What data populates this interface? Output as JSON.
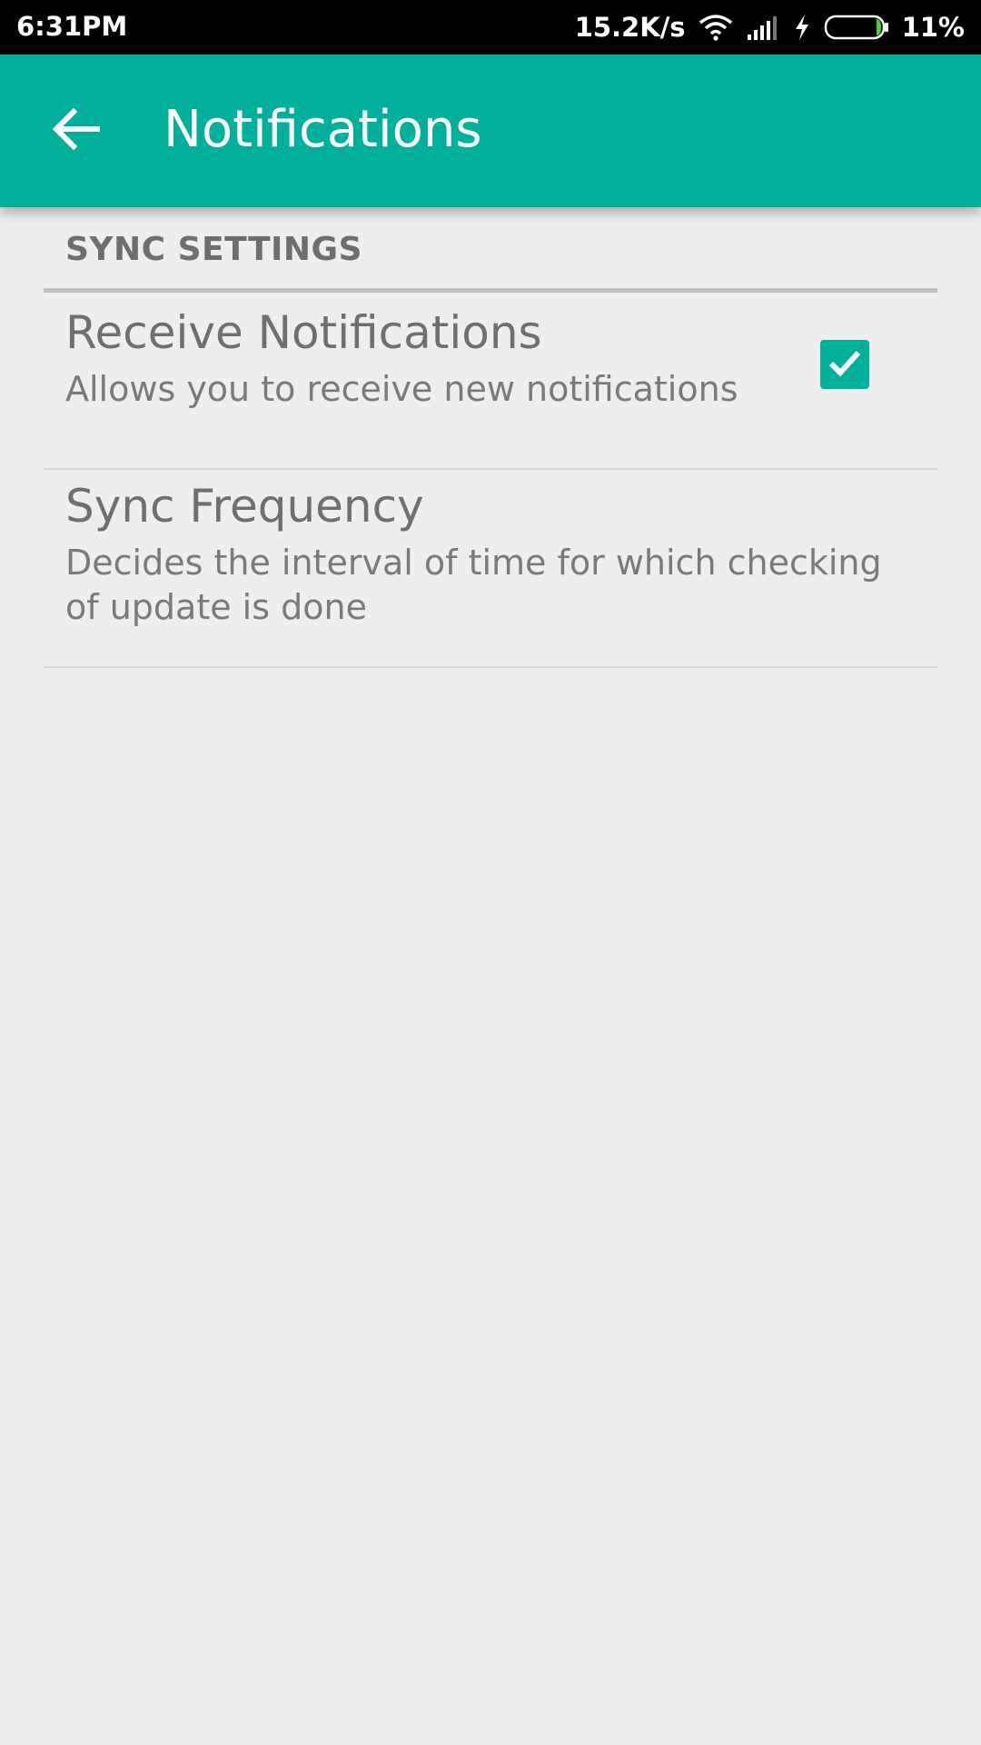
{
  "status_bar": {
    "time": "6:31PM",
    "network_speed": "15.2K/s",
    "battery_percent": "11%",
    "battery_level": 0.11,
    "icons": [
      "wifi-icon",
      "signal-icon",
      "charging-icon",
      "battery-icon"
    ]
  },
  "app_bar": {
    "title": "Notifications",
    "back_icon": "arrow-left-icon",
    "color": "#00b09b"
  },
  "section": {
    "header": "SYNC SETTINGS"
  },
  "preferences": [
    {
      "title": "Receive Notifications",
      "summary": "Allows you to receive new notifications",
      "checked": true
    },
    {
      "title": "Sync Frequency",
      "summary": "Decides the interval of time for which checking of update is done"
    }
  ],
  "colors": {
    "accent": "#00b09b",
    "background": "#eeeeee",
    "text_secondary": "#6f6f6f"
  }
}
